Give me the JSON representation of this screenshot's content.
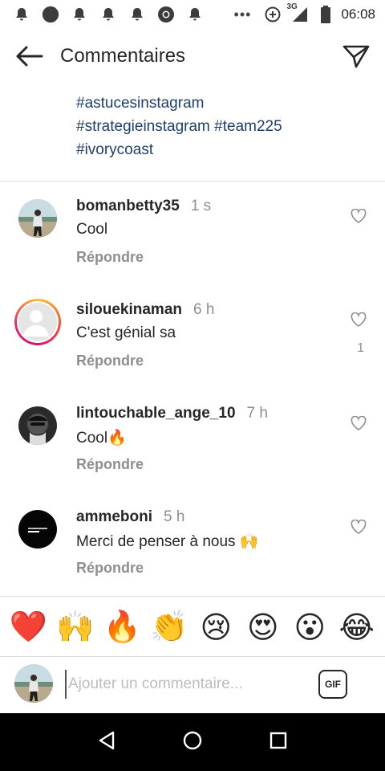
{
  "status_bar": {
    "network": "3G",
    "time": "06:08"
  },
  "header": {
    "title": "Commentaires"
  },
  "caption": {
    "hashtags": [
      "#astucesinstagram",
      "#strategieinstagram",
      "#team225",
      "#ivorycoast"
    ]
  },
  "comments": [
    {
      "username": "bomanbetty35",
      "time": "1 s",
      "text": "Cool",
      "reply": "Répondre",
      "likes": ""
    },
    {
      "username": "silouekinaman",
      "time": "6 h",
      "text": "C'est génial sa",
      "reply": "Répondre",
      "likes": "1"
    },
    {
      "username": "lintouchable_ange_10",
      "time": "7 h",
      "text": "Cool🔥",
      "reply": "Répondre",
      "likes": ""
    },
    {
      "username": "ammeboni",
      "time": "5 h",
      "text": "Merci de penser à nous 🙌",
      "reply": "Répondre",
      "likes": ""
    }
  ],
  "emoji_bar": [
    "❤️",
    "🙌",
    "🔥",
    "👏",
    "😢",
    "😍",
    "😮",
    "😂"
  ],
  "input": {
    "placeholder": "Ajouter un commentaire...",
    "gif_label": "GIF"
  },
  "icons": {
    "back": "arrow-left-icon",
    "send": "paper-plane-icon",
    "heart": "heart-outline-icon"
  },
  "colors": {
    "hashtag": "#1d3f6e",
    "muted": "#8e8e8e",
    "text": "#262626"
  }
}
